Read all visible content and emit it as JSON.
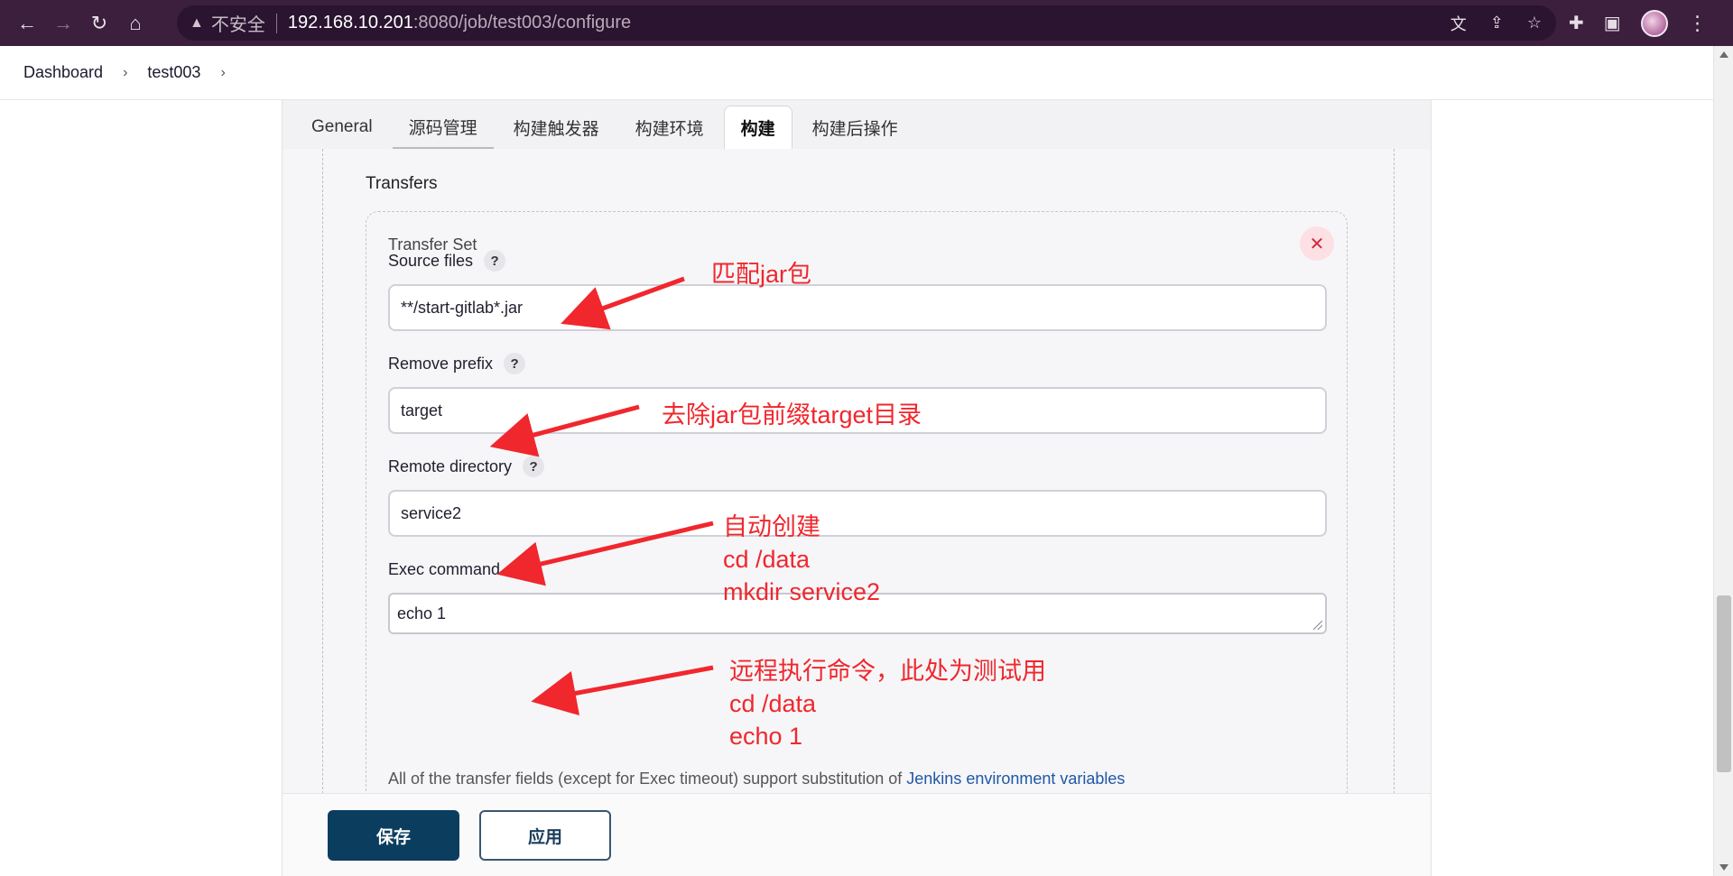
{
  "browser": {
    "security_label": "不安全",
    "url_host": "192.168.10.201",
    "url_path": ":8080/job/test003/configure",
    "icons": [
      "back-icon",
      "forward-icon",
      "reload-icon",
      "home-icon",
      "translate-icon",
      "share-icon",
      "star-icon",
      "extensions-icon",
      "sidepanel-icon",
      "profile-avatar",
      "menu-icon"
    ]
  },
  "breadcrumb": {
    "items": [
      "Dashboard",
      "test003"
    ]
  },
  "tabs": [
    {
      "label": "General"
    },
    {
      "label": "源码管理"
    },
    {
      "label": "构建触发器"
    },
    {
      "label": "构建环境"
    },
    {
      "label": "构建"
    },
    {
      "label": "构建后操作"
    }
  ],
  "active_tab": "构建",
  "section": {
    "title": "Transfers",
    "transfer_set_title": "Transfer Set"
  },
  "fields": {
    "source_files": {
      "label": "Source files",
      "value": "**/start-gitlab*.jar"
    },
    "remove_prefix": {
      "label": "Remove prefix",
      "value": "target"
    },
    "remote_directory": {
      "label": "Remote directory",
      "value": "service2"
    },
    "exec_command": {
      "label": "Exec command",
      "value": "echo 1"
    }
  },
  "help_label": "?",
  "close_label": "✕",
  "note": {
    "text": "All of the transfer fields (except for Exec timeout) support substitution of ",
    "link": "Jenkins environment variables"
  },
  "buttons": {
    "save": "保存",
    "apply": "应用"
  },
  "annotations": {
    "a1": "匹配jar包",
    "a2": "去除jar包前缀target目录",
    "a3": [
      "自动创建",
      "cd /data",
      "mkdir service2"
    ],
    "a4": [
      "远程执行命令，此处为测试用",
      "cd /data",
      "echo 1"
    ],
    "color": "#f0272d"
  },
  "colors": {
    "chrome": "#3c1f3c",
    "save_button": "#0b3d5f",
    "link": "#1f57a6"
  }
}
